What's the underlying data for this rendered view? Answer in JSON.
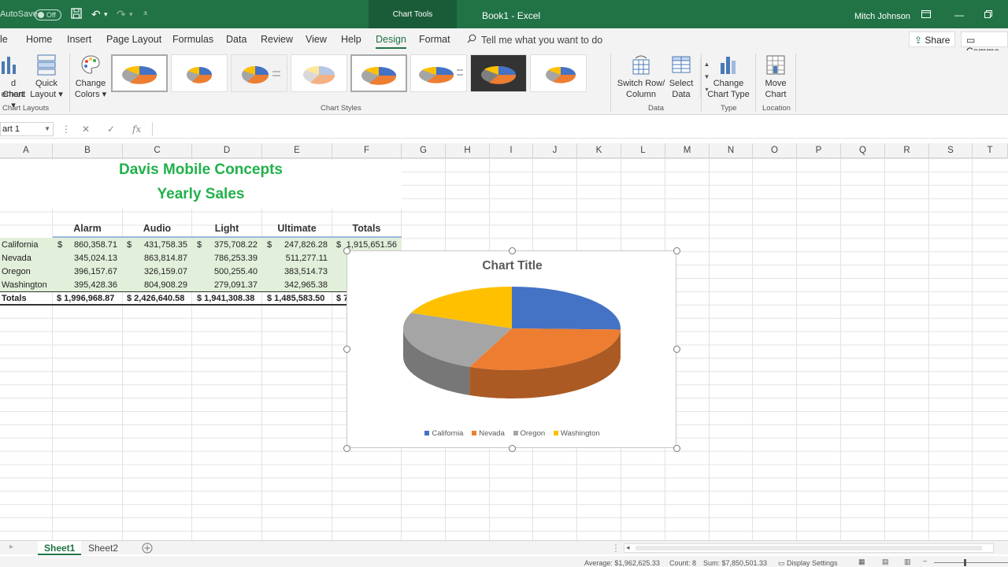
{
  "titlebar": {
    "autosave_label": "AutoSave",
    "autosave_state": "Off",
    "context_tab": "Chart Tools",
    "document_title": "Book1  -  Excel",
    "user_name": "Mitch Johnson"
  },
  "ribbon_tabs": [
    "Home",
    "Insert",
    "Page Layout",
    "Formulas",
    "Data",
    "Review",
    "View",
    "Help",
    "Design",
    "Format"
  ],
  "active_tab": "Design",
  "tell_me": "Tell me what you want to do",
  "share_label": "Share",
  "comments_label": "Comme",
  "ribbon": {
    "add_chart_element": "d Chart",
    "add_chart_element_2": "ement",
    "quick_layout": "Quick",
    "quick_layout_2": "Layout",
    "chart_layouts_group": "Chart Layouts",
    "change_colors": "Change",
    "change_colors_2": "Colors",
    "chart_styles_group": "Chart Styles",
    "switch_row_col": "Switch Row/",
    "switch_row_col_2": "Column",
    "select_data": "Select",
    "select_data_2": "Data",
    "data_group": "Data",
    "change_chart_type": "Change",
    "change_chart_type_2": "Chart Type",
    "type_group": "Type",
    "move_chart": "Move",
    "move_chart_2": "Chart",
    "location_group": "Location"
  },
  "formula_bar": {
    "name_box": "art 1",
    "fx": "fx"
  },
  "columns": [
    "A",
    "B",
    "C",
    "D",
    "E",
    "F",
    "G",
    "H",
    "I",
    "J",
    "K",
    "L",
    "M",
    "N",
    "O",
    "P",
    "Q",
    "R",
    "S",
    "T"
  ],
  "sheet": {
    "title": "Davis Mobile Concepts",
    "subtitle": "Yearly Sales",
    "headers": [
      "Alarm",
      "Audio",
      "Light",
      "Ultimate",
      "Totals"
    ],
    "rows": [
      {
        "label": "California",
        "b": "860,358.71",
        "c": "431,758.35",
        "d": "375,708.22",
        "e": "247,826.28",
        "f": "1,915,651.56"
      },
      {
        "label": "Nevada",
        "b": "345,024.13",
        "c": "863,814.87",
        "d": "786,253.39",
        "e": "511,277.11"
      },
      {
        "label": "Oregon",
        "b": "396,157.67",
        "c": "326,159.07",
        "d": "500,255.40",
        "e": "383,514.73"
      },
      {
        "label": "Washington",
        "b": "395,428.36",
        "c": "804,908.29",
        "d": "279,091.37",
        "e": "342,965.38"
      }
    ],
    "totals": {
      "label": "Totals",
      "b": "$ 1,996,968.87",
      "c": "$ 2,426,640.58",
      "d": "$ 1,941,308.38",
      "e": "$ 1,485,583.50",
      "f": "$ 7"
    },
    "dollar": "$"
  },
  "chart_data": {
    "type": "pie",
    "title": "Chart Title",
    "categories": [
      "California",
      "Nevada",
      "Oregon",
      "Washington"
    ],
    "values": [
      1996968.87,
      2426640.58,
      1941308.38,
      1485583.5
    ],
    "colors": [
      "#4472c4",
      "#ed7d31",
      "#a5a5a5",
      "#ffc000"
    ],
    "legend_position": "bottom"
  },
  "sheets": [
    "Sheet1",
    "Sheet2"
  ],
  "active_sheet": "Sheet1",
  "status": {
    "average": "Average: $1,962,625.33",
    "count": "Count: 8",
    "sum": "Sum: $7,850,501.33",
    "display_settings": "Display Settings"
  }
}
